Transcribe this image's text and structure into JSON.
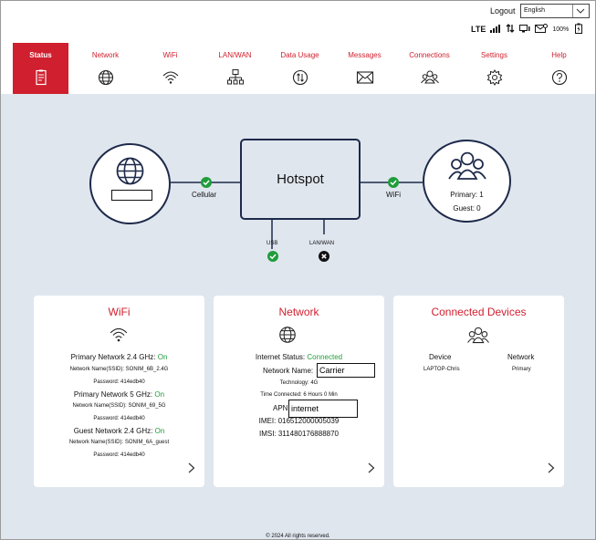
{
  "header": {
    "logout_label": "Logout",
    "language": "English",
    "network_type": "LTE",
    "battery": "100%"
  },
  "nav": {
    "tabs": [
      {
        "label": "Status",
        "icon": "clipboard-icon"
      },
      {
        "label": "Network",
        "icon": "globe-icon"
      },
      {
        "label": "WiFi",
        "icon": "wifi-icon"
      },
      {
        "label": "LAN/WAN",
        "icon": "lan-icon"
      },
      {
        "label": "Data Usage",
        "icon": "data-usage-icon"
      },
      {
        "label": "Messages",
        "icon": "envelope-icon"
      },
      {
        "label": "Connections",
        "icon": "users-icon"
      },
      {
        "label": "Settings",
        "icon": "gear-icon"
      },
      {
        "label": "Help",
        "icon": "help-icon"
      }
    ],
    "active": "Status"
  },
  "diagram": {
    "hub_label": "Hotspot",
    "cellular_label": "Cellular",
    "wifi_label": "WiFi",
    "primary_label": "Primary: 1",
    "guest_label": "Guest: 0",
    "usb_label": "USB",
    "lanwan_label": "LAN/WAN"
  },
  "cards": {
    "wifi": {
      "title": "WiFi",
      "primary24_label": "Primary Network 2.4 GHz:",
      "primary24_state": "On",
      "primary24_ssid": "Network Name(SSID): SONIM_6B_2.4G",
      "primary24_pass": "Password: 414edb40",
      "primary5_label": "Primary Network 5 GHz:",
      "primary5_state": "On",
      "primary5_ssid": "Network Name(SSID): SONIM_69_5G",
      "primary5_pass": "Password: 414edb40",
      "guest_label": "Guest Network 2.4 GHz:",
      "guest_state": "On",
      "guest_ssid": "Network Name(SSID): SONIM_6A_guest",
      "guest_pass": "Password: 414edb40"
    },
    "network": {
      "title": "Network",
      "internet_label": "Internet Status:",
      "internet_state": "Connected",
      "name_label": "Network Name:",
      "name_value": "Carrier",
      "technology": "Technology: 4G",
      "time_connected": "Time Connected: 6 Hours 0 Min",
      "apn_label": "APN:",
      "apn_value": "internet",
      "imei": "IMEI: 016512000005039",
      "imsi": "IMSI: 311480176888870"
    },
    "devices": {
      "title": "Connected Devices",
      "col_device": "Device",
      "col_network": "Network",
      "rows": [
        {
          "device": "LAPTOP-Chris",
          "network": "Primary"
        }
      ]
    }
  },
  "footer": {
    "copyright": "© 2024 All rights reserved."
  },
  "colors": {
    "accent": "#d01f2e",
    "ok": "#1f9d3b",
    "navy": "#1e2a4a",
    "background": "#dfe6ee"
  }
}
